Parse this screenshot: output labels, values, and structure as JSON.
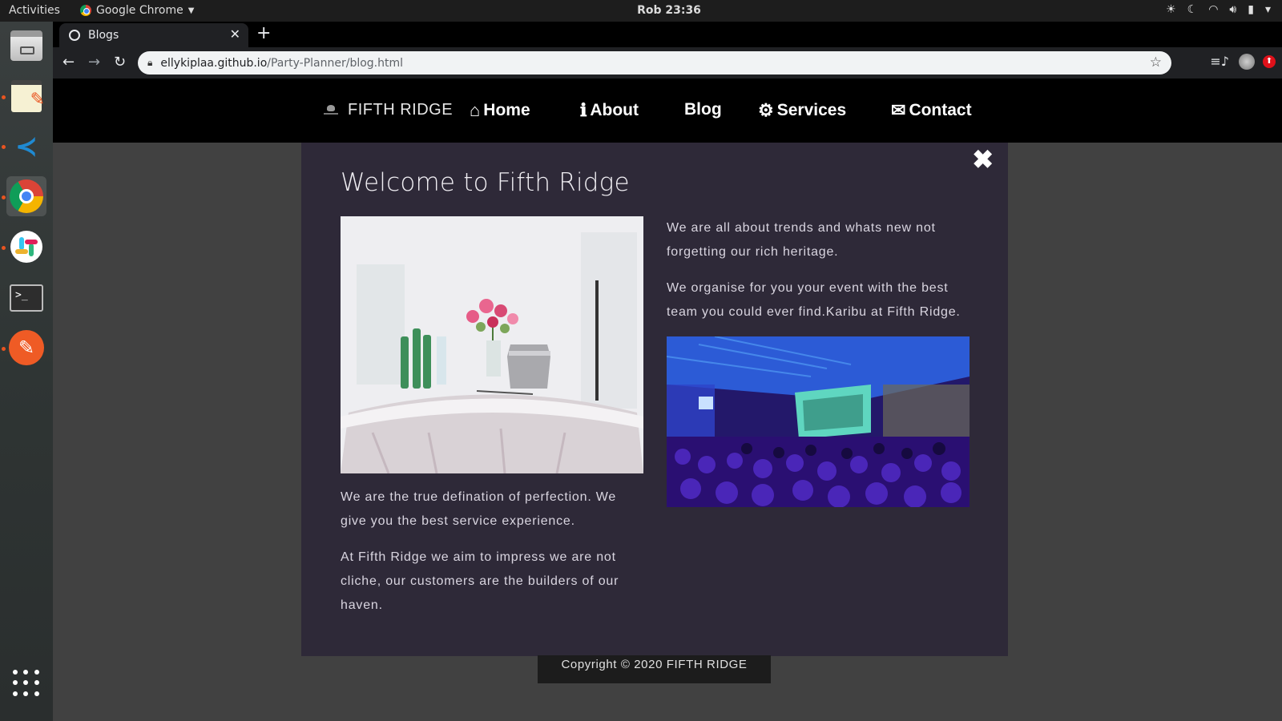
{
  "system": {
    "activities": "Activities",
    "app_name": "Google Chrome",
    "clock": "Rob 23:36"
  },
  "browser": {
    "tab_title": "Blogs",
    "url_host": "ellykiplaa.github.io",
    "url_path": "/Party-Planner/blog.html"
  },
  "site": {
    "brand": "FIFTH RIDGE",
    "nav": {
      "home": "Home",
      "about": "About",
      "blog": "Blog",
      "services": "Services",
      "contact": "Contact"
    }
  },
  "modal": {
    "title": "Welcome to Fifth Ridge",
    "left_paragraphs": [
      "We are the true defination of perfection. We give you the best service experience.",
      "At Fifth Ridge we aim to impress we are not cliche, our customers are the builders of our haven."
    ],
    "right_paragraphs": [
      "We are all about trends and whats new not forgetting our rich heritage.",
      "We organise for you your event with the best team you could ever find.Karibu at Fifth Ridge."
    ]
  },
  "footer": {
    "copyright": "Copyright © 2020 FIFTH RIDGE"
  },
  "colors": {
    "modal_bg": "#2e2938",
    "page_bg": "#414141",
    "nav_bg": "#000000",
    "footer_bg": "#1c1c1c"
  },
  "icons": [
    "chrome-icon",
    "globe-icon",
    "home-icon",
    "info-icon",
    "gears-icon",
    "envelope-icon",
    "close-icon",
    "lock-icon",
    "star-icon"
  ]
}
